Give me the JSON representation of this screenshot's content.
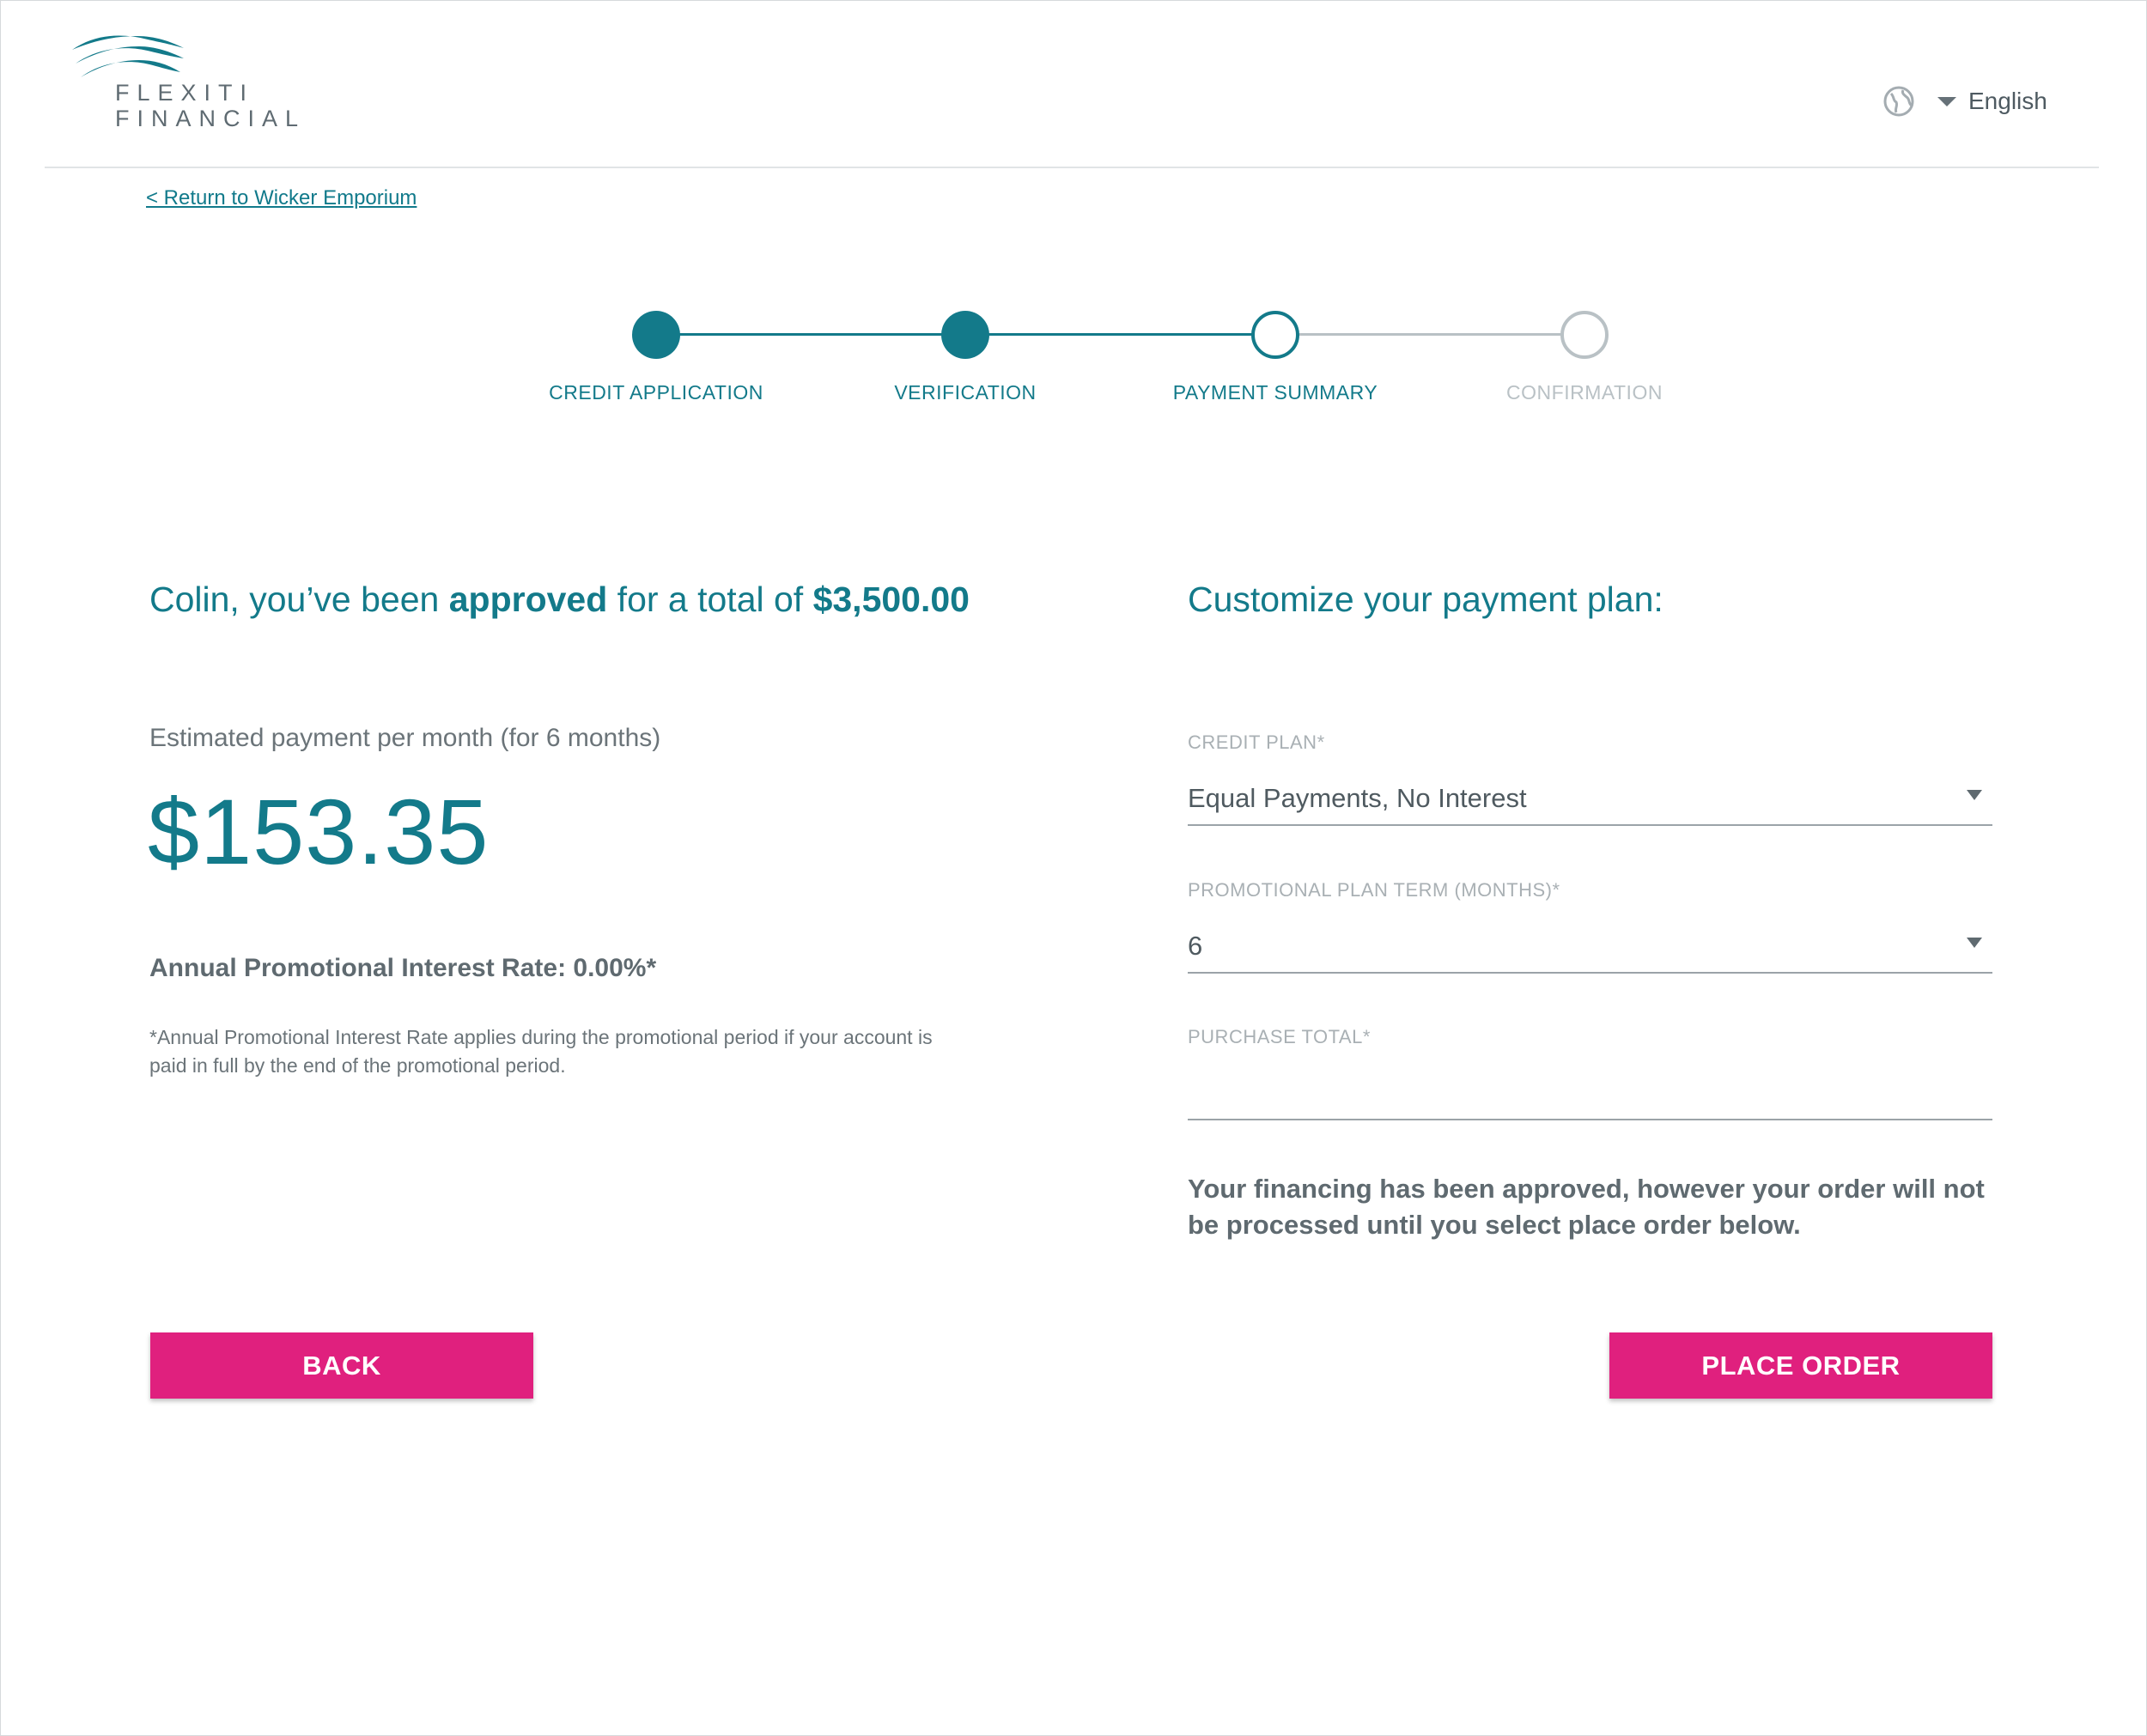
{
  "brand": {
    "name_line1": "FLEXITI",
    "name_line2": "FINANCIAL",
    "color": "#137a8a"
  },
  "header": {
    "language": "English",
    "globe_icon": "globe-icon",
    "dropdown_icon": "caret-down-icon"
  },
  "nav": {
    "return_link": "< Return to Wicker Emporium"
  },
  "stepper": {
    "steps": [
      {
        "label": "CREDIT APPLICATION",
        "state": "completed"
      },
      {
        "label": "VERIFICATION",
        "state": "completed"
      },
      {
        "label": "PAYMENT SUMMARY",
        "state": "current"
      },
      {
        "label": "CONFIRMATION",
        "state": "upcoming"
      }
    ],
    "active_color": "#137a8a",
    "inactive_color": "#b9c1c5"
  },
  "approval": {
    "greeting": "Colin, you’ve been ",
    "status_word": "approved",
    "middle": " for a total of ",
    "total": "$3,500.00"
  },
  "estimate": {
    "label": "Estimated payment per month (for 6 months)",
    "amount": "$153.35",
    "rate_line": "Annual Promotional Interest Rate: 0.00%*",
    "footnote": "*Annual Promotional Interest Rate applies during the promotional period if your account is paid in full by the end of the promotional period."
  },
  "plan": {
    "title": "Customize your payment plan:",
    "credit_plan_label": "CREDIT PLAN*",
    "credit_plan_value": "Equal Payments, No Interest",
    "term_label": "PROMOTIONAL PLAN TERM (MONTHS)*",
    "term_value": "6",
    "purchase_total_label": "PURCHASE TOTAL*",
    "purchase_total_value": "",
    "notice": "Your financing has been approved, however your order will not be processed until you select place order below."
  },
  "actions": {
    "back_label": "BACK",
    "place_order_label": "PLACE ORDER",
    "button_color": "#e0207e"
  }
}
